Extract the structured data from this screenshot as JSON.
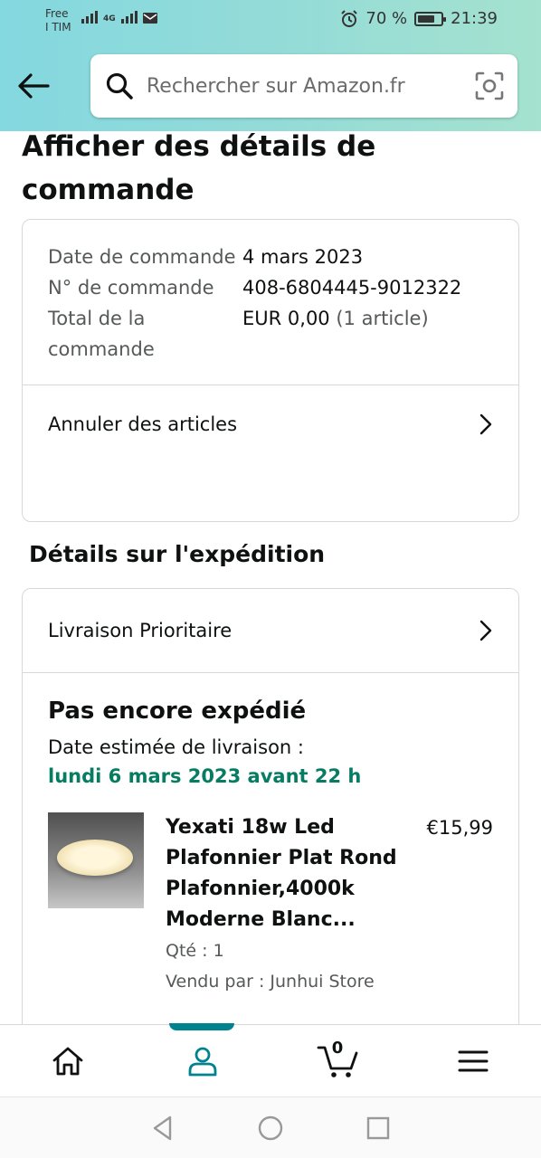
{
  "status_bar": {
    "carrier_line1": "Free",
    "carrier_line2": "I TIM",
    "network": "4G",
    "battery": "70 %",
    "time": "21:39",
    "battery_level": 0.7
  },
  "search": {
    "placeholder": "Rechercher sur Amazon.fr"
  },
  "page": {
    "title": "Afficher des détails de commande"
  },
  "order_details": {
    "rows": [
      {
        "label": "Date de commande",
        "value": "4 mars 2023",
        "extra": ""
      },
      {
        "label": "N° de commande",
        "value": "408-6804445-9012322",
        "extra": ""
      },
      {
        "label": "Total de la commande",
        "value": "EUR 0,00",
        "extra": "(1 article)"
      }
    ],
    "cancel_label": "Annuler des articles"
  },
  "shipping": {
    "section_title": "Détails sur l'expédition",
    "method": "Livraison Prioritaire",
    "status": "Pas encore expédié",
    "delivery_label": "Date estimée de livraison :",
    "delivery_date": "lundi 6 mars 2023 avant 22 h",
    "item": {
      "name": "Yexati 18w Led Plafonnier Plat Rond Plafonnier,4000k Moderne Blanc...",
      "price": "€15,99",
      "qty": "Qté : 1",
      "seller": "Vendu par : Junhui Store"
    }
  },
  "nav": {
    "cart_count": "0",
    "active_tab": "account"
  },
  "colors": {
    "accent": "#00838f",
    "delivery_green": "#067d62"
  }
}
